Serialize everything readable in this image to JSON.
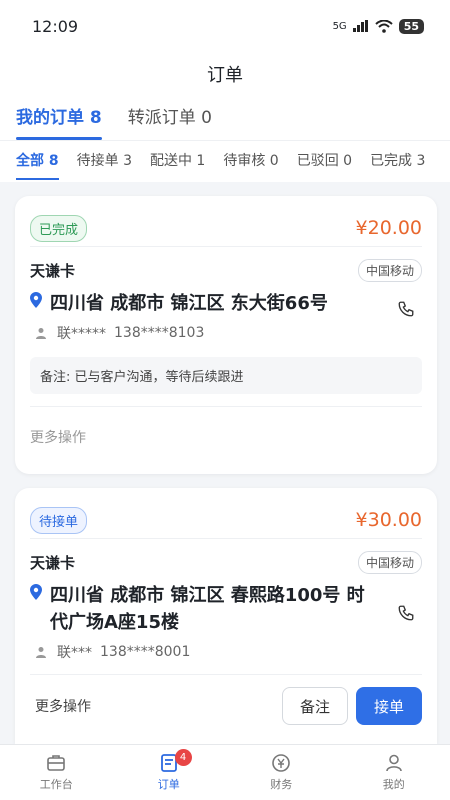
{
  "status_bar": {
    "time": "12:09",
    "network": "5G",
    "battery": "55"
  },
  "header": {
    "title": "订单"
  },
  "main_tabs": [
    {
      "label": "我的订单 8"
    },
    {
      "label": "转派订单 0"
    }
  ],
  "sub_tabs": [
    {
      "label": "全部 8"
    },
    {
      "label": "待接单 3"
    },
    {
      "label": "配送中 1"
    },
    {
      "label": "待审核 0"
    },
    {
      "label": "已驳回 0"
    },
    {
      "label": "已完成 3"
    }
  ],
  "orders": [
    {
      "status": "已完成",
      "price": "¥20.00",
      "product": "天谦卡",
      "carrier": "中国移动",
      "address": "四川省 成都市 锦江区 东大街66号",
      "contact_name": "联*****",
      "contact_phone": "138****8103",
      "note": "备注: 已与客户沟通，等待后续跟进",
      "more_label": "更多操作"
    },
    {
      "status": "待接单",
      "price": "¥30.00",
      "product": "天谦卡",
      "carrier": "中国移动",
      "address": "四川省 成都市 锦江区 春熙路100号 时代广场A座15楼",
      "contact_name": "联***",
      "contact_phone": "138****8001",
      "more_label": "更多操作",
      "note_button": "备注",
      "accept_button": "接单"
    }
  ],
  "bottom_nav": [
    {
      "label": "工作台",
      "icon": "workbench-icon"
    },
    {
      "label": "订单",
      "icon": "order-icon",
      "badge": "4"
    },
    {
      "label": "财务",
      "icon": "finance-icon"
    },
    {
      "label": "我的",
      "icon": "profile-icon"
    }
  ],
  "colors": {
    "accent": "#2c6ae0",
    "price": "#e8672e",
    "done": "#2e9a56"
  }
}
